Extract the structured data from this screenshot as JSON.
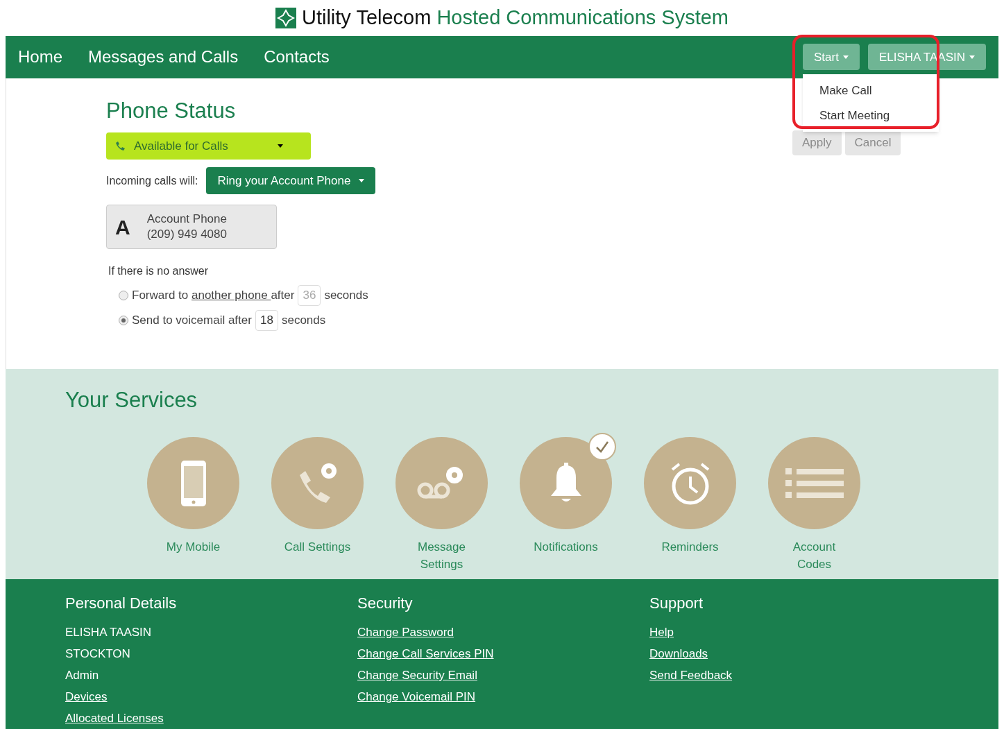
{
  "header": {
    "brand": "Utility Telecom",
    "product": "Hosted Communications System"
  },
  "nav": {
    "items": [
      {
        "label": "Home"
      },
      {
        "label": "Messages and Calls"
      },
      {
        "label": "Contacts"
      }
    ],
    "start_button": "Start",
    "user_button": "ELISHA TAASIN",
    "start_menu": {
      "expanded": true,
      "highlighted": true,
      "items": [
        "Make Call",
        "Start Meeting"
      ]
    }
  },
  "phone_status": {
    "title": "Phone Status",
    "status": "Available for Calls",
    "incoming_label": "Incoming calls will:",
    "incoming_value": "Ring your Account Phone",
    "device": {
      "letter": "A",
      "name": "Account Phone",
      "number": "(209) 949 4080"
    },
    "no_answer_label": "If there is no answer",
    "options": [
      {
        "kind": "forward",
        "selected": false,
        "before": "Forward to ",
        "link": "another phone ",
        "after": "after",
        "seconds": "36",
        "unit": "seconds"
      },
      {
        "kind": "voicemail",
        "selected": true,
        "before": "Send to voicemail after",
        "seconds": "18",
        "unit": "seconds"
      }
    ],
    "apply": {
      "label": "Apply",
      "disabled": true
    },
    "cancel": {
      "label": "Cancel",
      "disabled": true
    }
  },
  "services": {
    "title": "Your Services",
    "items": [
      {
        "kind": "mobile",
        "label": "My Mobile",
        "checked": false
      },
      {
        "kind": "call-settings",
        "label": "Call Settings",
        "checked": false
      },
      {
        "kind": "message-settings",
        "label": "Message Settings",
        "checked": false
      },
      {
        "kind": "notifications",
        "label": "Notifications",
        "checked": true
      },
      {
        "kind": "reminders",
        "label": "Reminders",
        "checked": false
      },
      {
        "kind": "account-codes",
        "label": "Account Codes",
        "checked": false
      }
    ]
  },
  "footer": {
    "columns": [
      {
        "title": "Personal Details",
        "items": [
          {
            "text": "ELISHA TAASIN",
            "link": false
          },
          {
            "text": "STOCKTON",
            "link": false
          },
          {
            "text": "Admin",
            "link": false
          },
          {
            "text": "Devices",
            "link": true
          },
          {
            "text": "Allocated Licenses",
            "link": true
          }
        ]
      },
      {
        "title": "Security",
        "items": [
          {
            "text": "Change Password",
            "link": true
          },
          {
            "text": "Change Call Services PIN",
            "link": true
          },
          {
            "text": "Change Security Email",
            "link": true
          },
          {
            "text": "Change Voicemail PIN",
            "link": true
          }
        ]
      },
      {
        "title": "Support",
        "items": [
          {
            "text": "Help",
            "link": true
          },
          {
            "text": "Downloads",
            "link": true
          },
          {
            "text": "Send Feedback",
            "link": true
          }
        ]
      }
    ]
  }
}
